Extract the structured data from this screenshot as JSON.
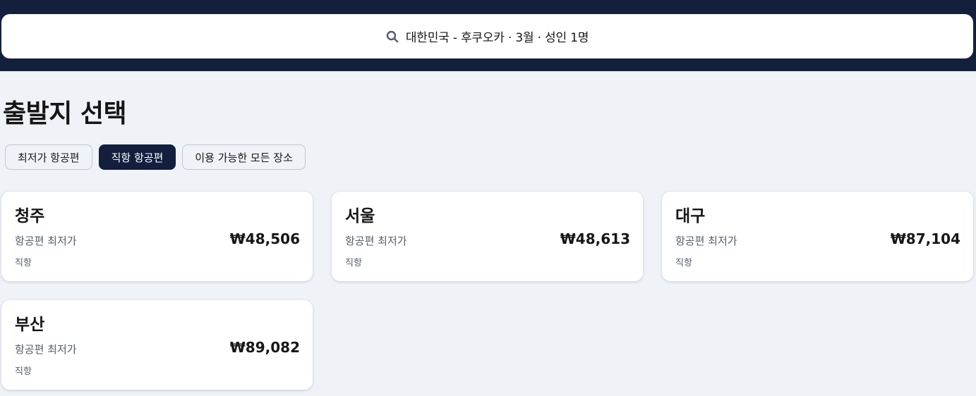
{
  "search": {
    "icon": "search-icon",
    "summary": "대한민국 - 후쿠오카 · 3월 · 성인 1명"
  },
  "page": {
    "title": "출발지 선택"
  },
  "filters": [
    {
      "label": "최저가 항공편",
      "active": false
    },
    {
      "label": "직항 항공편",
      "active": true
    },
    {
      "label": "이용 가능한 모든 장소",
      "active": false
    }
  ],
  "cards": [
    {
      "city": "청주",
      "label": "항공편 최저가",
      "price": "₩48,506",
      "sub": "직항"
    },
    {
      "city": "서울",
      "label": "항공편 최저가",
      "price": "₩48,613",
      "sub": "직항"
    },
    {
      "city": "대구",
      "label": "항공편 최저가",
      "price": "₩87,104",
      "sub": "직항"
    },
    {
      "city": "부산",
      "label": "항공편 최저가",
      "price": "₩89,082",
      "sub": "직항"
    }
  ],
  "colors": {
    "header_bg": "#131f3c",
    "page_bg": "#eff3f8",
    "active_chip": "#131f3c"
  }
}
